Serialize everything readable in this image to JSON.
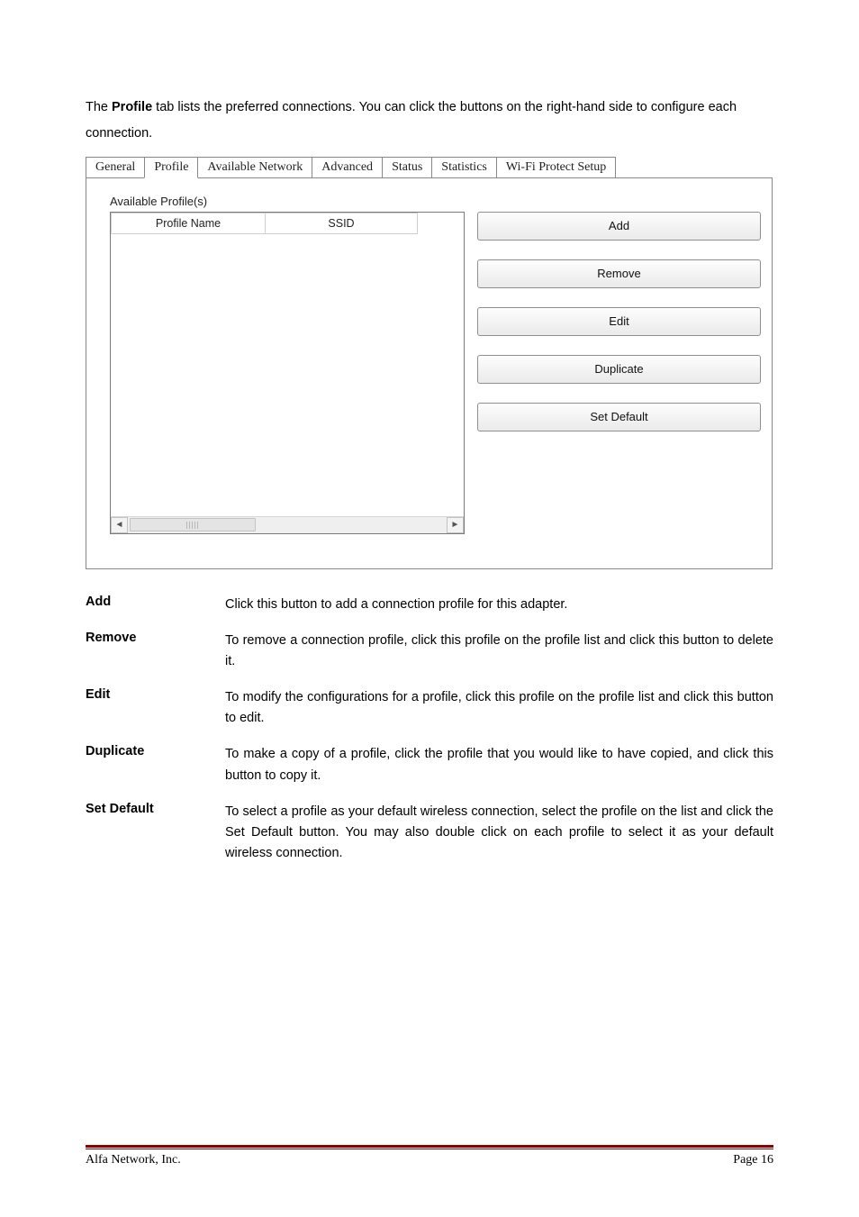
{
  "intro": {
    "part1": "The ",
    "bold": "Profile",
    "part2": " tab lists the preferred connections. You can click the buttons on the right-hand side to configure each connection."
  },
  "tabs": {
    "general": "General",
    "profile": "Profile",
    "available_network": "Available Network",
    "advanced": "Advanced",
    "status": "Status",
    "statistics": "Statistics",
    "wifi": "Wi-Fi Protect Setup"
  },
  "panel": {
    "available_label": "Available Profile(s)",
    "col_profile_name": "Profile Name",
    "col_ssid": "SSID",
    "buttons": {
      "add": "Add",
      "remove": "Remove",
      "edit": "Edit",
      "duplicate": "Duplicate",
      "set_default": "Set Default"
    }
  },
  "defs": {
    "add": {
      "term": "Add",
      "body": "Click this button to add a connection profile for this adapter."
    },
    "remove": {
      "term": "Remove",
      "body": "To remove a connection profile, click this profile on the profile list and click this button to delete it."
    },
    "edit": {
      "term": "Edit",
      "body": "To modify the configurations for a profile, click this profile on the profile list and click this button to edit."
    },
    "duplicate": {
      "term": "Duplicate",
      "body": "To make a copy of a profile, click the profile that you would like to have copied, and click this button to copy it."
    },
    "set_default": {
      "term": "Set Default",
      "body": "To select a profile as your default wireless connection, select the profile on the list and click the Set Default button. You may also double click on each profile to select it as your default wireless connection."
    }
  },
  "footer": {
    "left": "Alfa Network, Inc.",
    "right": "Page 16"
  }
}
